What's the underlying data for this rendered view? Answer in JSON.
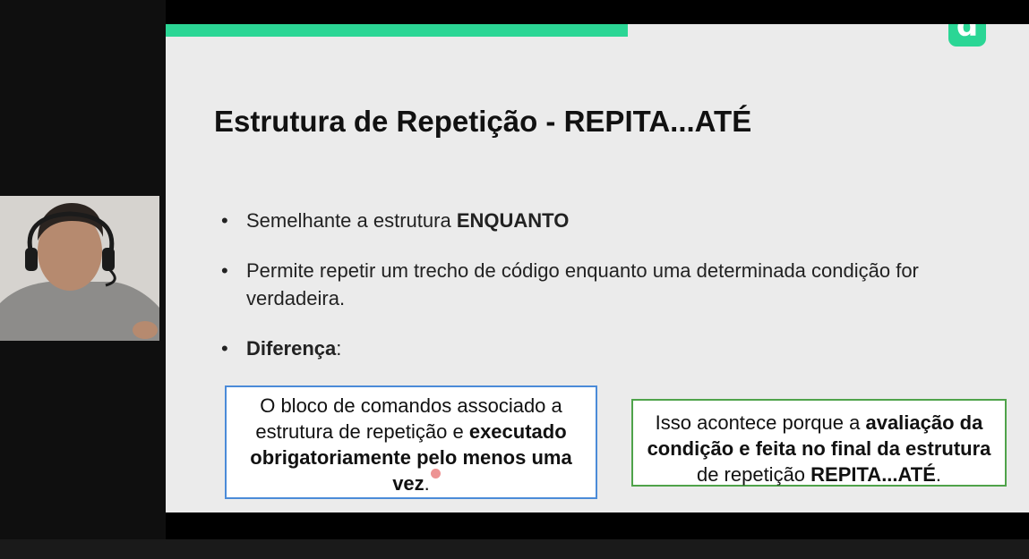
{
  "slide": {
    "logo_letter": "d",
    "title": "Estrutura de Repetição - REPITA...ATÉ",
    "bullet1_text": "Semelhante a estrutura ",
    "bullet1_bold": "ENQUANTO",
    "bullet2_text": "Permite repetir um trecho de código enquanto uma determinada condição for verdadeira.",
    "bullet3_bold": "Diferença",
    "bullet3_text": ":",
    "box_blue": {
      "text_start": "O bloco de comandos associado a estrutura de repetição e ",
      "text_bold": "executado obrigatoriamente pelo menos uma vez",
      "text_end": "."
    },
    "box_green": {
      "text_start": "Isso acontece porque a ",
      "text_bold": "avaliação da condição e feita no final da estrutura",
      "text_mid": " de repetição ",
      "text_bold2": "REPITA...ATÉ",
      "text_end": "."
    }
  },
  "colors": {
    "accent": "#2bd695",
    "blue_border": "#4b8bd8",
    "green_border": "#4fa34a",
    "slide_bg": "#ebebeb"
  },
  "icons": {
    "logo": "brand-d-logo",
    "cursor": "mouse-pointer-icon"
  }
}
